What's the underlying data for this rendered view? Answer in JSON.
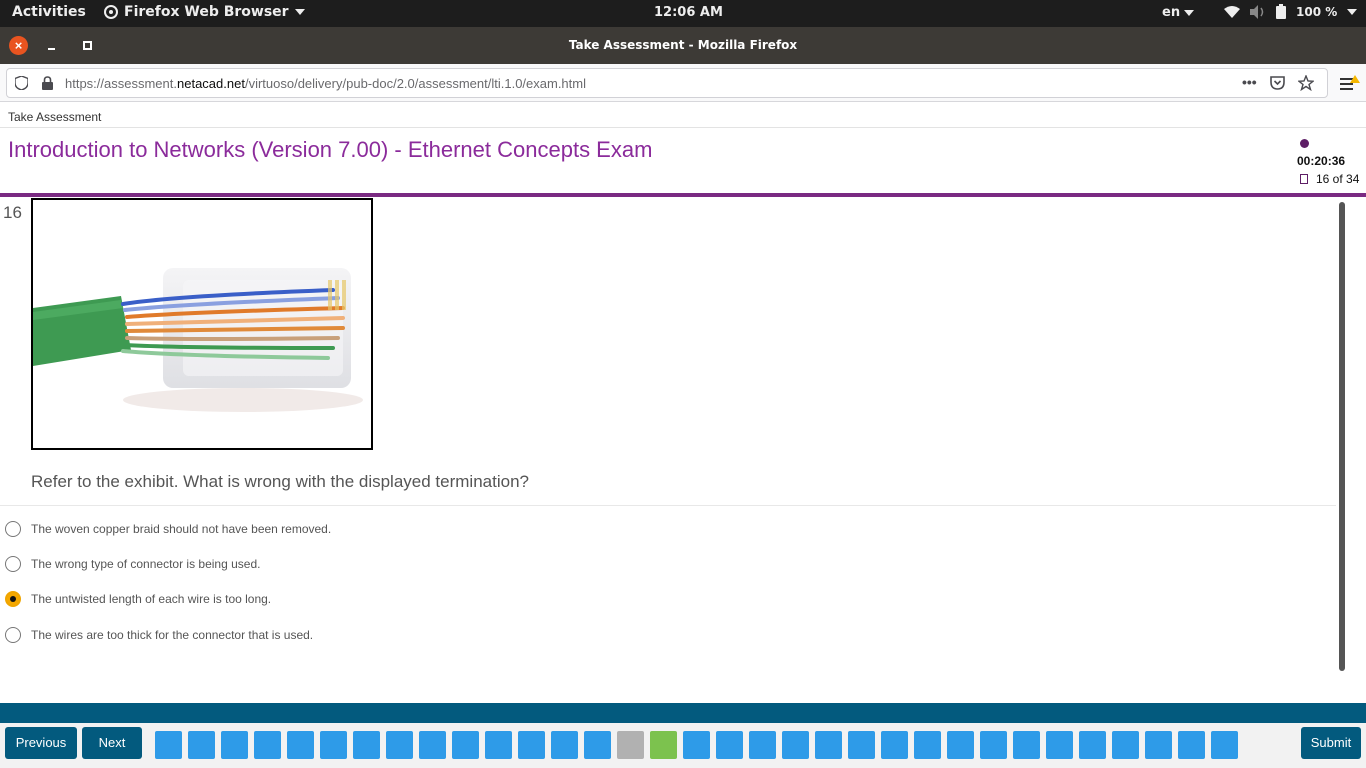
{
  "system": {
    "activities": "Activities",
    "app_name": "Firefox Web Browser",
    "clock": "12:06 AM",
    "language": "en",
    "battery": "100 %"
  },
  "window": {
    "title": "Take Assessment - Mozilla Firefox"
  },
  "browser": {
    "url_prefix": "https://assessment.",
    "url_domain": "netacad.net",
    "url_suffix": "/virtuoso/delivery/pub-doc/2.0/assessment/lti.1.0/exam.html"
  },
  "page": {
    "breadcrumb": "Take Assessment",
    "title": "Introduction to Networks (Version 7.00) - Ethernet Concepts Exam",
    "timer": "00:20:36",
    "question_counter": "16 of 34"
  },
  "question": {
    "number": "16",
    "text": "Refer to the exhibit. What is wrong with the displayed termination?",
    "options": [
      {
        "label": "The woven copper braid should not have been removed.",
        "selected": false
      },
      {
        "label": "The wrong type of connector is being used.",
        "selected": false
      },
      {
        "label": "The untwisted length of each wire is too long.",
        "selected": true
      },
      {
        "label": "The wires are too thick for the connector that is used.",
        "selected": false
      }
    ]
  },
  "footer": {
    "previous_label": "Previous",
    "next_label": "Next",
    "submit_label": "Submit",
    "total_questions": 34,
    "current_question": 15,
    "flagged_question": 16
  },
  "colors": {
    "title_purple": "#8b2b9b",
    "accent_purple": "#7a2a82",
    "teal": "#035a7e",
    "square_blue": "#2e9be8",
    "square_current": "#b1b1b1",
    "square_flagged": "#7cc24e",
    "radio_selected": "#f5a800"
  }
}
